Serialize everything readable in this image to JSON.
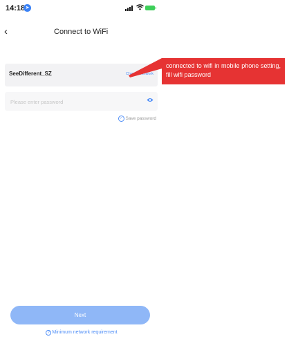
{
  "status_bar": {
    "time": "14:18"
  },
  "nav": {
    "back_glyph": "‹",
    "title": "Connect to WiFi"
  },
  "wifi": {
    "ssid": "SeeDifferent_SZ",
    "change_label": "Change network"
  },
  "password": {
    "placeholder": "Please enter password",
    "value": "",
    "save_label": "Save password",
    "save_checked": true
  },
  "callout": {
    "text": "connected to wifi in mobile phone setting, fill wifi password",
    "color": "#e63333"
  },
  "footer": {
    "next_label": "Next",
    "requirement_label": "Minimum network requirement",
    "requirement_icon": "?"
  },
  "colors": {
    "accent": "#4f8ef7",
    "button_disabled": "#8fb7f7"
  },
  "icons": {
    "location": "location-icon",
    "signal": "signal-icon",
    "wifi_status": "wifi-icon",
    "battery": "battery-charging-icon",
    "eye": "eye-icon",
    "check": "check-circle-icon",
    "help": "help-circle-icon"
  }
}
